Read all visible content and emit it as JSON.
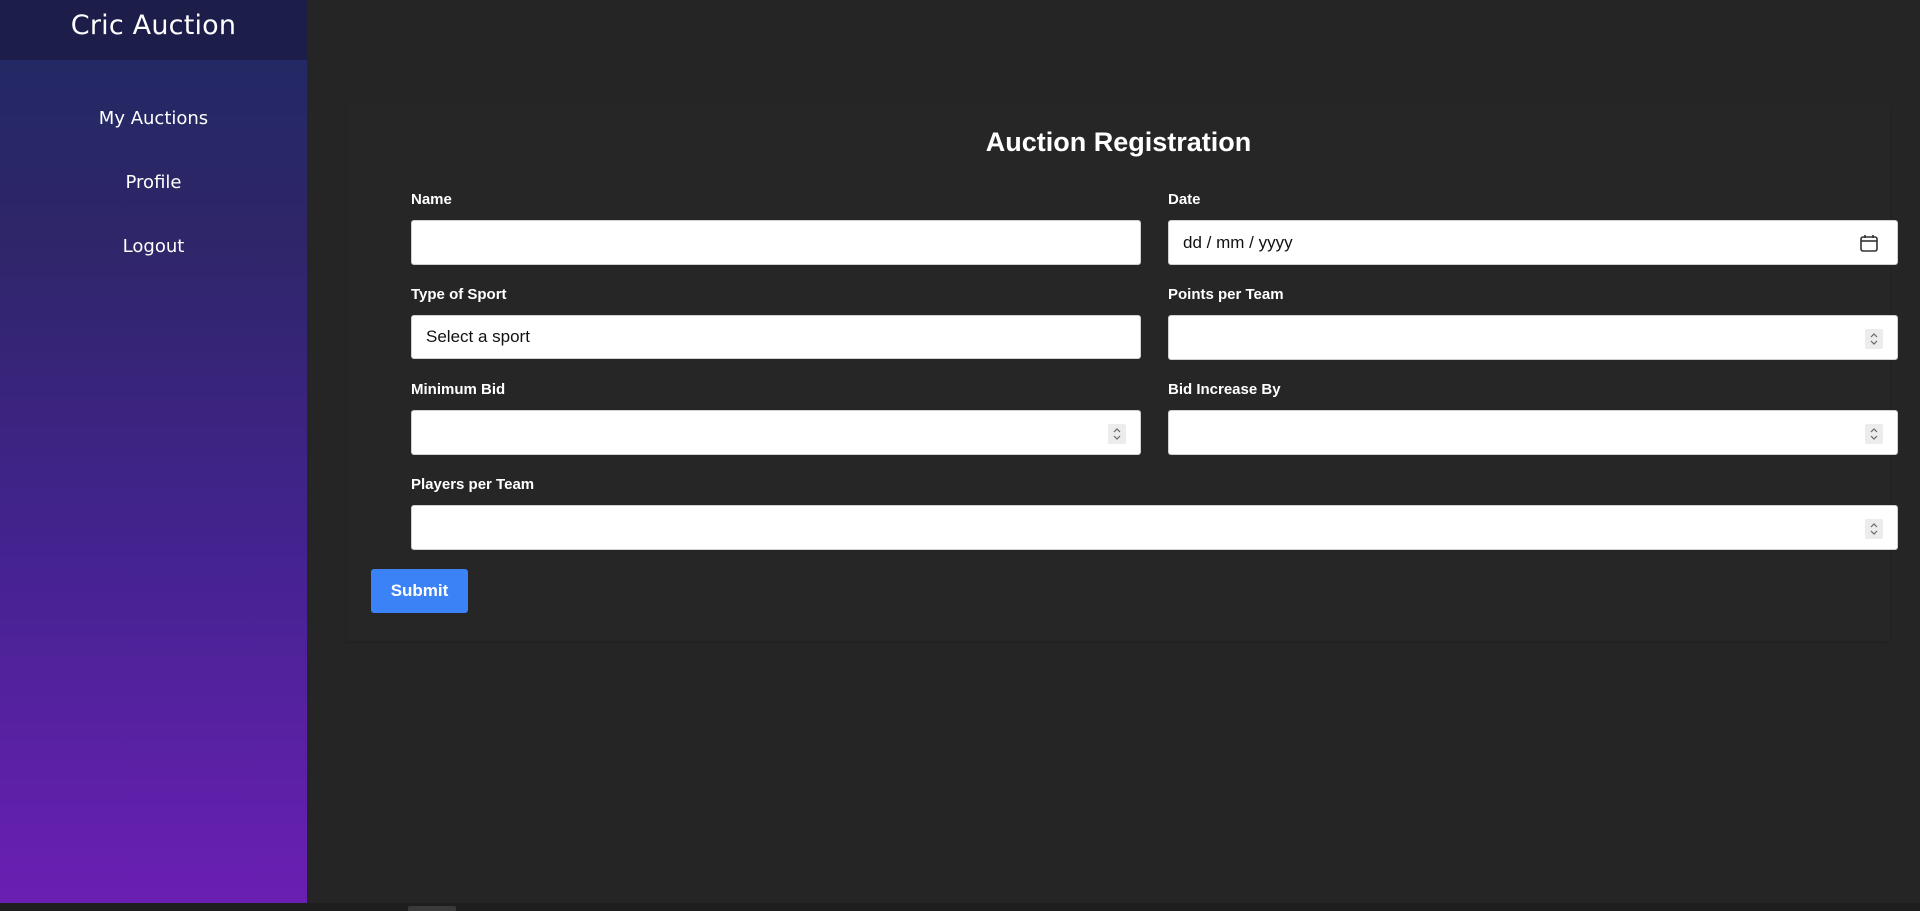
{
  "app": {
    "title": "Cric Auction"
  },
  "sidebar": {
    "items": [
      {
        "label": "My Auctions"
      },
      {
        "label": "Profile"
      },
      {
        "label": "Logout"
      }
    ]
  },
  "form": {
    "title": "Auction Registration",
    "fields": {
      "name": {
        "label": "Name",
        "value": ""
      },
      "date": {
        "label": "Date",
        "placeholder": "dd / mm / yyyy"
      },
      "sport": {
        "label": "Type of Sport",
        "selected": "Select a sport"
      },
      "points": {
        "label": "Points per Team",
        "value": ""
      },
      "min_bid": {
        "label": "Minimum Bid",
        "value": ""
      },
      "bid_increase": {
        "label": "Bid Increase By",
        "value": ""
      },
      "players": {
        "label": "Players per Team",
        "value": ""
      }
    },
    "submit_label": "Submit"
  },
  "colors": {
    "accent": "#3b82f6",
    "background": "#252525",
    "sidebar_top": "#1f2a63",
    "sidebar_bottom": "#6a1fb3"
  }
}
